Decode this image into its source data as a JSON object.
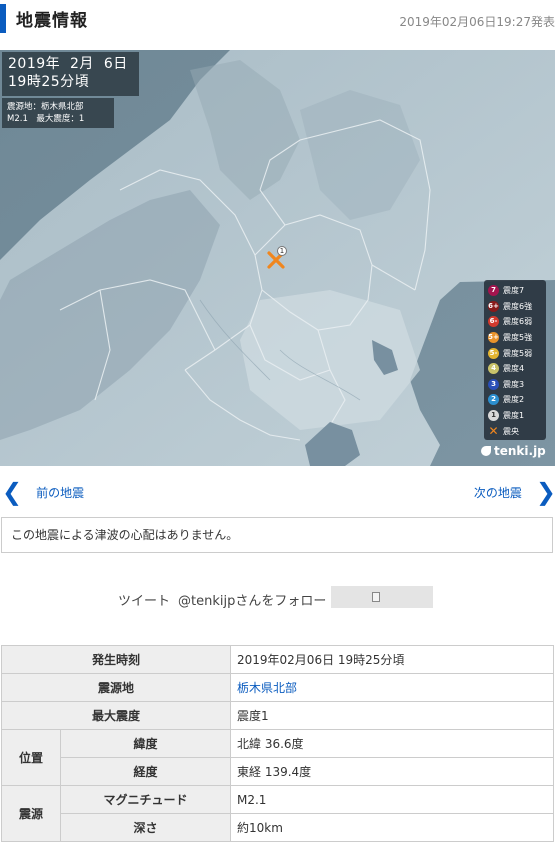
{
  "header": {
    "title": "地震情報",
    "published": "2019年02月06日19:27発表"
  },
  "map": {
    "date_line1": "2019年  2月  6日",
    "date_line2": "19時25分頃",
    "epicenter_line": "震源地：栃木県北部",
    "magnitude_line": "M2.1　最大震度：1",
    "epicenter_marker_label": "1",
    "legend": [
      {
        "mark": "7",
        "label": "震度7",
        "color": "#a3144e"
      },
      {
        "mark": "6+",
        "label": "震度6強",
        "color": "#8a1a1a"
      },
      {
        "mark": "6-",
        "label": "震度6弱",
        "color": "#d23a2e"
      },
      {
        "mark": "5+",
        "label": "震度5強",
        "color": "#e8932b"
      },
      {
        "mark": "5-",
        "label": "震度5弱",
        "color": "#e3b431"
      },
      {
        "mark": "4",
        "label": "震度4",
        "color": "#c8c26a"
      },
      {
        "mark": "3",
        "label": "震度3",
        "color": "#2a4fb8"
      },
      {
        "mark": "2",
        "label": "震度2",
        "color": "#2c8fcf"
      },
      {
        "mark": "1",
        "label": "震度1",
        "color": "#d9d9d9"
      },
      {
        "mark": "✕",
        "label": "震央",
        "color": "#f0861e"
      }
    ],
    "brand": "tenki.jp"
  },
  "nav": {
    "prev_label": "前の地震",
    "next_label": "次の地震"
  },
  "tsunami_notice": "この地震による津波の心配はありません。",
  "social": {
    "tweet": "ツイート",
    "follow": "@tenkijpさんをフォロー"
  },
  "table": {
    "occurred_label": "発生時刻",
    "occurred_value": "2019年02月06日 19時25分頃",
    "epicenter_label": "震源地",
    "epicenter_value": "栃木県北部",
    "max_intensity_label": "最大震度",
    "max_intensity_value": "震度1",
    "position_label": "位置",
    "latitude_label": "緯度",
    "latitude_value": "北緯 36.6度",
    "longitude_label": "経度",
    "longitude_value": "東経 139.4度",
    "source_label": "震源",
    "magnitude_label": "マグニチュード",
    "magnitude_value": "M2.1",
    "depth_label": "深さ",
    "depth_value": "約10km"
  }
}
